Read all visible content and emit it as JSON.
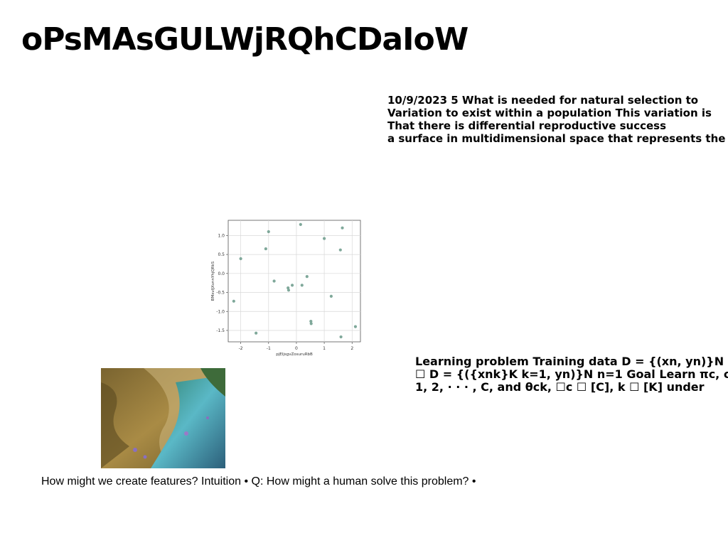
{
  "title": "oPsMAsGULWjRQhCDaIoW",
  "right_top": {
    "lines": [
      "10/9/2023 5 What is needed for natural selection to",
      "Variation to exist within a population This variation is",
      "That there is differential reproductive success",
      "a surface in multidimensional space that represents the"
    ]
  },
  "right_mid": {
    "lines": [
      "Learning problem Training data D = {(xn, yn)}N",
      "☐ D = {({xnk}K k=1, yn)}N n=1 Goal Learn πc, c",
      "1, 2, · · · , C, and θck, ☐c ☐ [C], k ☐ [K] under"
    ]
  },
  "bottom_text": "How might we create features? Intuition • Q: How might a human solve this problem? •",
  "chart_data": {
    "type": "scatter",
    "xlabel": "pjEIjsgvZosuruRbB",
    "ylabel": "BMxvIJXvnnYhjQRkS",
    "xlim": [
      -2.45,
      2.3
    ],
    "ylim": [
      -1.8,
      1.4
    ],
    "xticks": [
      "-2",
      "-1",
      "0",
      "1",
      "2"
    ],
    "xtick_values": [
      -2,
      -1,
      0,
      1,
      2
    ],
    "yticks": [
      "1.0",
      "0.5",
      "0.0",
      "-0.5",
      "-1.0",
      "-1.5"
    ],
    "ytick_values": [
      1.0,
      0.5,
      0.0,
      -0.5,
      -1.0,
      -1.5
    ],
    "grid": true,
    "point_color": "#7fa89a",
    "points": [
      {
        "x": -2.25,
        "y": -0.73
      },
      {
        "x": -2.0,
        "y": 0.39
      },
      {
        "x": -1.45,
        "y": -1.57
      },
      {
        "x": -1.1,
        "y": 0.65
      },
      {
        "x": -1.0,
        "y": 1.1
      },
      {
        "x": -0.8,
        "y": -0.2
      },
      {
        "x": -0.3,
        "y": -0.38
      },
      {
        "x": -0.28,
        "y": -0.44
      },
      {
        "x": -0.15,
        "y": -0.31
      },
      {
        "x": 0.15,
        "y": 1.29
      },
      {
        "x": 0.2,
        "y": -0.31
      },
      {
        "x": 0.38,
        "y": -0.08
      },
      {
        "x": 0.52,
        "y": -1.26
      },
      {
        "x": 0.53,
        "y": -1.32
      },
      {
        "x": 1.0,
        "y": 0.92
      },
      {
        "x": 1.25,
        "y": -0.6
      },
      {
        "x": 1.58,
        "y": 0.62
      },
      {
        "x": 1.6,
        "y": -1.67
      },
      {
        "x": 1.65,
        "y": 1.2
      },
      {
        "x": 2.12,
        "y": -1.4
      }
    ]
  },
  "photo": {
    "description_icon": "coastal-landscape-photo",
    "colors": [
      "#6b5a2a",
      "#a88a3c",
      "#3a8fa0",
      "#5fb7c4",
      "#2c6a4a"
    ]
  }
}
